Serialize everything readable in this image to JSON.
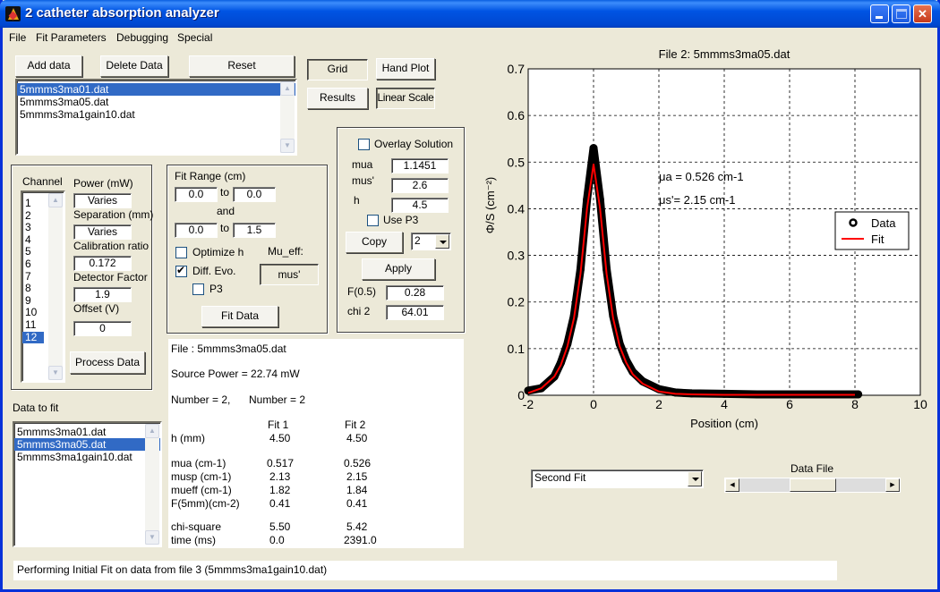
{
  "window": {
    "title": "2 catheter absorption analyzer",
    "controls": [
      "minimize",
      "maximize",
      "close"
    ]
  },
  "menu": [
    "File",
    "Fit Parameters",
    "Debugging",
    "Special"
  ],
  "file_buttons": {
    "add": "Add data",
    "delete": "Delete Data",
    "reset": "Reset"
  },
  "file_list": {
    "items": [
      "5mmms3ma01.dat",
      "5mmms3ma05.dat",
      "5mmms3ma1gain10.dat"
    ],
    "selected_index": 0
  },
  "plot_buttons": {
    "grid": "Grid",
    "hand_plot": "Hand Plot",
    "results": "Results",
    "linear_scale": "Linear Scale"
  },
  "channel_panel": {
    "title": "Channel",
    "channels": [
      "1",
      "2",
      "3",
      "4",
      "5",
      "6",
      "7",
      "8",
      "9",
      "10",
      "11",
      "12"
    ],
    "selected_index": 11,
    "power_label": "Power (mW)",
    "power_value": "Varies",
    "separation_label": "Separation (mm)",
    "separation_value": "Varies",
    "calibration_label": "Calibration ratio",
    "calibration_value": "0.172",
    "detector_label": "Detector Factor",
    "detector_value": "1.9",
    "offset_label": "Offset (V)",
    "offset_value": "0",
    "process_button": "Process Data"
  },
  "fit_panel": {
    "title": "Fit Range (cm)",
    "range1_from": "0.0",
    "range1_to": "0.0",
    "to_label": "to",
    "and_label": "and",
    "range2_from": "0.0",
    "range2_to": "1.5",
    "optimize_h_label": "Optimize h",
    "optimize_h_checked": false,
    "diff_evo_label": "Diff. Evo.",
    "diff_evo_checked": true,
    "p3_label": "P3",
    "p3_checked": false,
    "mu_eff_label": "Mu_eff:",
    "mu_eff_button": "mus'",
    "fit_button": "Fit Data"
  },
  "overlay_panel": {
    "overlay_label": "Overlay Solution",
    "overlay_checked": false,
    "mua_label": "mua",
    "mua_value": "1.1451",
    "mus_label": "mus'",
    "mus_value": "2.6",
    "h_label": "h",
    "h_value": "4.5",
    "use_p3_label": "Use P3",
    "use_p3_checked": false,
    "copy_button": "Copy",
    "copy_select": "2",
    "apply_button": "Apply",
    "f05_label": "F(0.5)",
    "f05_value": "0.28",
    "chi2_label": "chi 2",
    "chi2_value": "64.01"
  },
  "results": {
    "file_line": "File   : 5mmms3ma05.dat",
    "power_line": "Source Power = 22.74 mW",
    "number_a": "Number = 2,",
    "number_b": "Number = 2",
    "col_headers": [
      "Fit 1",
      "Fit 2"
    ],
    "rows": [
      {
        "label": "h    (mm)",
        "fit1": "4.50",
        "fit2": "4.50"
      },
      {
        "label": "mua   (cm-1)",
        "fit1": "0.517",
        "fit2": "0.526"
      },
      {
        "label": "musp  (cm-1)",
        "fit1": "2.13",
        "fit2": "2.15"
      },
      {
        "label": "mueff (cm-1)",
        "fit1": "1.82",
        "fit2": "1.84"
      },
      {
        "label": "F(5mm)(cm-2)",
        "fit1": "0.41",
        "fit2": "0.41"
      },
      {
        "label": "chi-square",
        "fit1": "5.50",
        "fit2": "5.42"
      },
      {
        "label": "time (ms)",
        "fit1": "0.0",
        "fit2": "2391.0"
      }
    ]
  },
  "data_to_fit": {
    "label": "Data to fit",
    "items": [
      "5mmms3ma01.dat",
      "5mmms3ma05.dat",
      "5mmms3ma1gain10.dat"
    ],
    "selected_index": 1
  },
  "fit_select": {
    "value": "Second Fit"
  },
  "data_file_slider": {
    "label": "Data File",
    "position": 0.5
  },
  "status": "Performing Initial Fit on data from file 3 (5mmms3ma1gain10.dat)",
  "chart_data": {
    "type": "line",
    "title": "File 2: 5mmms3ma05.dat",
    "xlabel": "Position (cm)",
    "ylabel": "Φ/S (cm⁻²)",
    "xlim": [
      -2,
      10
    ],
    "ylim": [
      0,
      0.7
    ],
    "xticks": [
      -2,
      0,
      2,
      4,
      6,
      8,
      10
    ],
    "yticks": [
      0,
      0.1,
      0.2,
      0.3,
      0.4,
      0.5,
      0.6,
      0.7
    ],
    "ytick_labels": [
      "0",
      "0.1",
      "0.2",
      "0.3",
      "0.4",
      "0.5",
      "0.6",
      "0.7"
    ],
    "grid": true,
    "legend": {
      "placement": "right",
      "entries": [
        "Data",
        "Fit"
      ]
    },
    "annotation": {
      "mua_text": "μa =  0.526 cm-1",
      "mus_text": "μs'=   2.15 cm-1"
    },
    "series": [
      {
        "name": "Data",
        "style": "markers",
        "color": "#000000",
        "x": [
          -2.0,
          -1.6,
          -1.2,
          -1.0,
          -0.8,
          -0.6,
          -0.4,
          -0.2,
          0.0,
          0.2,
          0.4,
          0.6,
          0.8,
          1.0,
          1.2,
          1.5,
          2.0,
          2.5,
          3.0,
          4.0,
          5.0,
          6.0,
          7.0,
          8.0,
          8.1
        ],
        "y": [
          0.01,
          0.015,
          0.04,
          0.07,
          0.11,
          0.17,
          0.27,
          0.42,
          0.53,
          0.42,
          0.27,
          0.17,
          0.11,
          0.075,
          0.05,
          0.03,
          0.013,
          0.006,
          0.004,
          0.003,
          0.002,
          0.002,
          0.002,
          0.002,
          0.002
        ]
      },
      {
        "name": "Fit",
        "style": "line",
        "color": "#ff0000",
        "x": [
          -2.0,
          -1.6,
          -1.2,
          -1.0,
          -0.8,
          -0.6,
          -0.4,
          -0.2,
          0.0,
          0.2,
          0.4,
          0.6,
          0.8,
          1.0,
          1.2,
          1.5,
          2.0,
          2.5,
          3.0,
          4.0,
          5.0,
          6.0,
          7.0,
          8.0
        ],
        "y": [
          0.005,
          0.015,
          0.04,
          0.065,
          0.105,
          0.165,
          0.26,
          0.4,
          0.495,
          0.4,
          0.26,
          0.165,
          0.105,
          0.07,
          0.045,
          0.025,
          0.008,
          0.003,
          0.002,
          0.001,
          0.001,
          0.001,
          0.001,
          0.001
        ]
      }
    ]
  }
}
